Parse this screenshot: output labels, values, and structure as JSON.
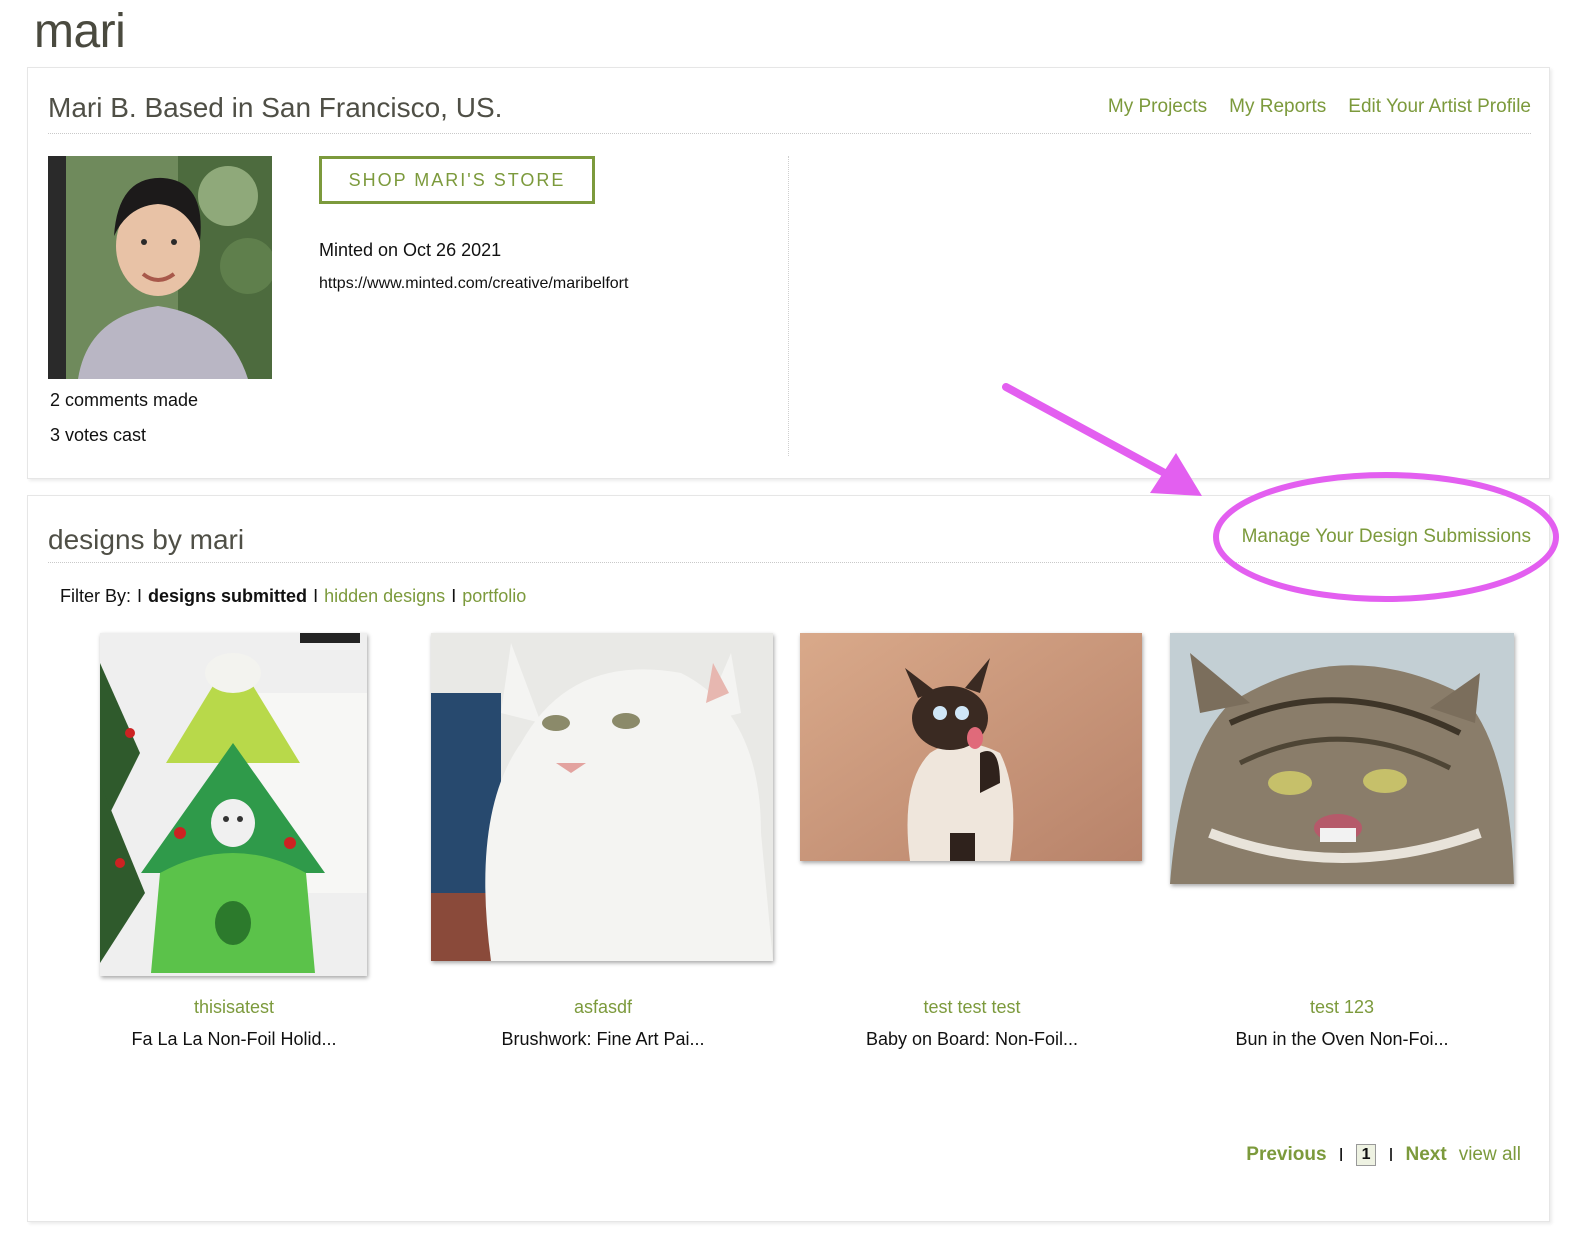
{
  "page": {
    "title": "mari"
  },
  "profile": {
    "heading": "Mari B. Based in San Francisco, US.",
    "links": {
      "projects": "My Projects",
      "reports": "My Reports",
      "edit_profile": "Edit Your Artist Profile"
    },
    "shop_button": "SHOP MARI'S STORE",
    "minted_on": "Minted on Oct 26 2021",
    "url": "https://www.minted.com/creative/maribelfort",
    "comments": "2 comments made",
    "votes": "3 votes cast"
  },
  "designs": {
    "heading": "designs by mari",
    "manage_link": "Manage Your Design Submissions",
    "filter": {
      "label": "Filter By:",
      "separator": "I",
      "current": "designs submitted",
      "hidden": "hidden designs",
      "portfolio": "portfolio"
    },
    "items": [
      {
        "title": "thisisatest",
        "product": "Fa La La Non-Foil Holid..."
      },
      {
        "title": "asfasdf",
        "product": "Brushwork: Fine Art Pai..."
      },
      {
        "title": "test test test",
        "product": "Baby on Board: Non-Foil..."
      },
      {
        "title": "test 123",
        "product": "Bun in the Oven Non-Foi..."
      }
    ],
    "pager": {
      "previous": "Previous",
      "separator": "I",
      "current_page": "1",
      "next": "Next",
      "view_all": "view all"
    }
  },
  "icons": {
    "annotation_arrow": "arrow-icon",
    "annotation_ellipse": "ellipse-highlight"
  },
  "colors": {
    "accent": "#7c9a3c",
    "annotation": "#e35ff0"
  }
}
